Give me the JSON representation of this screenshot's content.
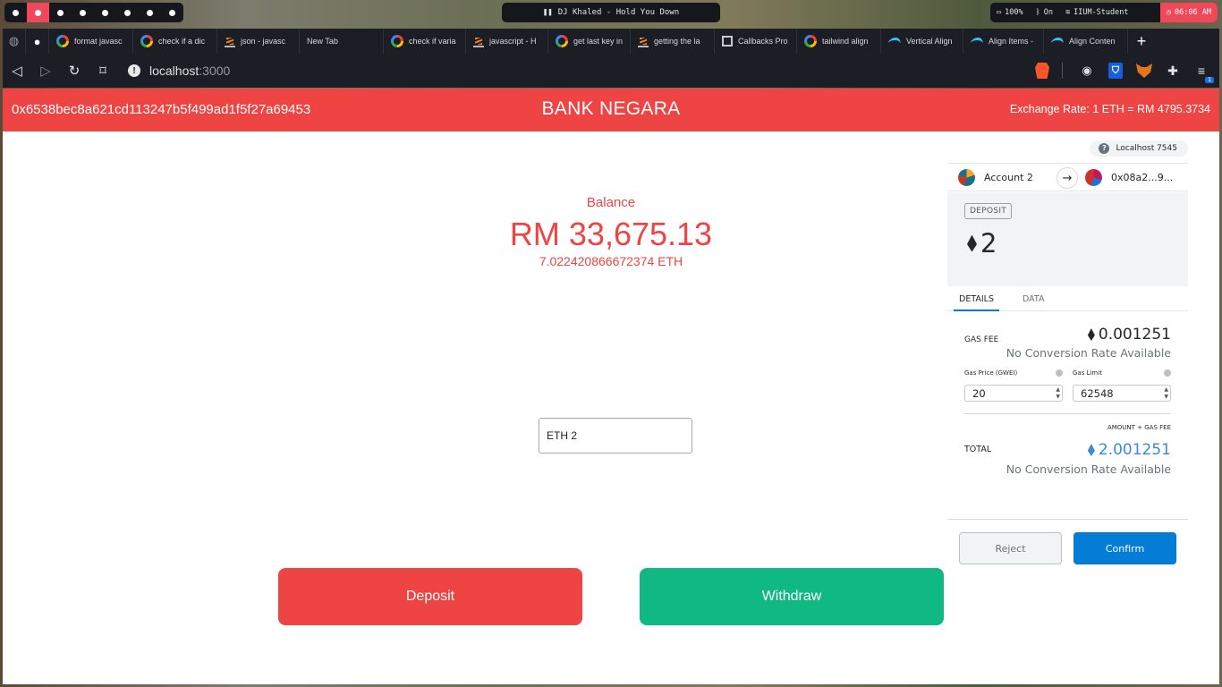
{
  "system_bar": {
    "workspaces": 8,
    "active_workspace": 2,
    "media": "DJ Khaled - Hold You Down",
    "battery": "100%",
    "bluetooth": "On",
    "wifi": "IIUM-Student",
    "time": "06:06 AM"
  },
  "tabs": [
    {
      "icon": "github-icon",
      "label": ""
    },
    {
      "icon": "google-icon",
      "label": "format javasc"
    },
    {
      "icon": "google-icon",
      "label": "check if a dic"
    },
    {
      "icon": "stackoverflow-icon",
      "label": "json - javasc"
    },
    {
      "icon": "",
      "label": "New Tab"
    },
    {
      "icon": "google-icon",
      "label": "check if varia"
    },
    {
      "icon": "stackoverflow-icon",
      "label": "javascript - H"
    },
    {
      "icon": "google-icon",
      "label": "get last key in"
    },
    {
      "icon": "stackoverflow-icon",
      "label": "getting the la"
    },
    {
      "icon": "book-icon",
      "label": "Callbacks Pro"
    },
    {
      "icon": "google-icon",
      "label": "tailwind align"
    },
    {
      "icon": "tailwind-icon",
      "label": "Vertical Align"
    },
    {
      "icon": "tailwind-icon",
      "label": "Align Items -"
    },
    {
      "icon": "tailwind-icon",
      "label": "Align Conten"
    }
  ],
  "address_bar": {
    "host": "localhost",
    "port": ":3000"
  },
  "extensions": {
    "metamask_badge": "1"
  },
  "app": {
    "wallet_address": "0x6538bec8a621cd113247b5f499ad1f5f27a69453",
    "brand": "BANK NEGARA",
    "exchange_rate": "Exchange Rate:  1 ETH = RM 4795.3734",
    "balance_label": "Balance",
    "balance_rm": "RM 33,675.13",
    "balance_eth": "7.022420866672374 ETH",
    "amount_value": "ETH 2",
    "deposit_label": "Deposit",
    "withdraw_label": "Withdraw"
  },
  "metamask": {
    "network": "Localhost 7545",
    "from_account": "Account 2",
    "to_account": "0x08a2...9...",
    "action_tag": "DEPOSIT",
    "amount": "2",
    "tab_details": "DETAILS",
    "tab_data": "DATA",
    "gas_fee_label": "GAS FEE",
    "gas_fee_value": "0.001251",
    "no_conversion": "No Conversion Rate Available",
    "gas_price_label": "Gas Price (GWEI)",
    "gas_price_value": "20",
    "gas_limit_label": "Gas Limit",
    "gas_limit_value": "62548",
    "amount_gas_label": "AMOUNT + GAS FEE",
    "total_label": "TOTAL",
    "total_value": "2.001251",
    "reject_label": "Reject",
    "confirm_label": "Confirm"
  }
}
